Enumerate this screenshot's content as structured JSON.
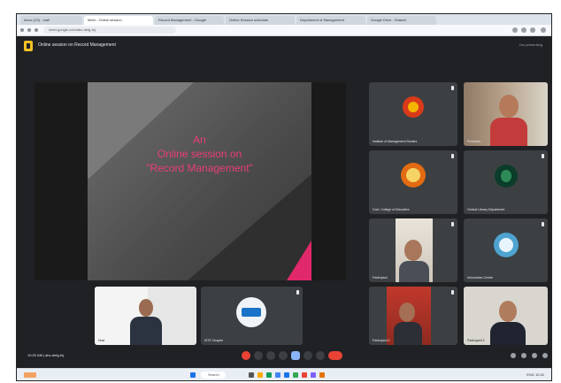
{
  "browser": {
    "tabs": [
      "Inbox (23) - mail",
      "Meet - Online session",
      "Record Management - Google",
      "Online Session schedule",
      "Department of Management",
      "Google Drive - Shared"
    ],
    "url": "meet.google.com/abc-defg-hij",
    "active_tab_index": 1
  },
  "meet": {
    "title": "Online session on Record Management",
    "header_right": "You presenting"
  },
  "slide": {
    "line1": "An",
    "line2": "Online session on",
    "line3": "\"Record Management\""
  },
  "participants": [
    {
      "name": "Institute of Management Studies",
      "kind": "logo-red"
    },
    {
      "name": "Presenter",
      "kind": "person"
    },
    {
      "name": "Govt. College of Education",
      "kind": "logo-orange"
    },
    {
      "name": "Central Library Department",
      "kind": "logo-green"
    },
    {
      "name": "Participant",
      "kind": "person"
    },
    {
      "name": "Information Centre",
      "kind": "logo-blue"
    },
    {
      "name": "Participant 2",
      "kind": "person"
    },
    {
      "name": "Participant 3",
      "kind": "person"
    }
  ],
  "bottom_tiles": [
    {
      "name": "Host",
      "kind": "person"
    },
    {
      "name": "ISTE Chapter",
      "kind": "logo-blue"
    }
  ],
  "controls": {
    "time": "10:32 AM | abc-defg-hij"
  },
  "taskbar": {
    "search": "Search",
    "tray": "ENG  10:32"
  },
  "colors": {
    "meet_bg": "#202124",
    "tile_bg": "#3c4043",
    "slide_text": "#ea3d7a",
    "end_call": "#ea4335"
  }
}
